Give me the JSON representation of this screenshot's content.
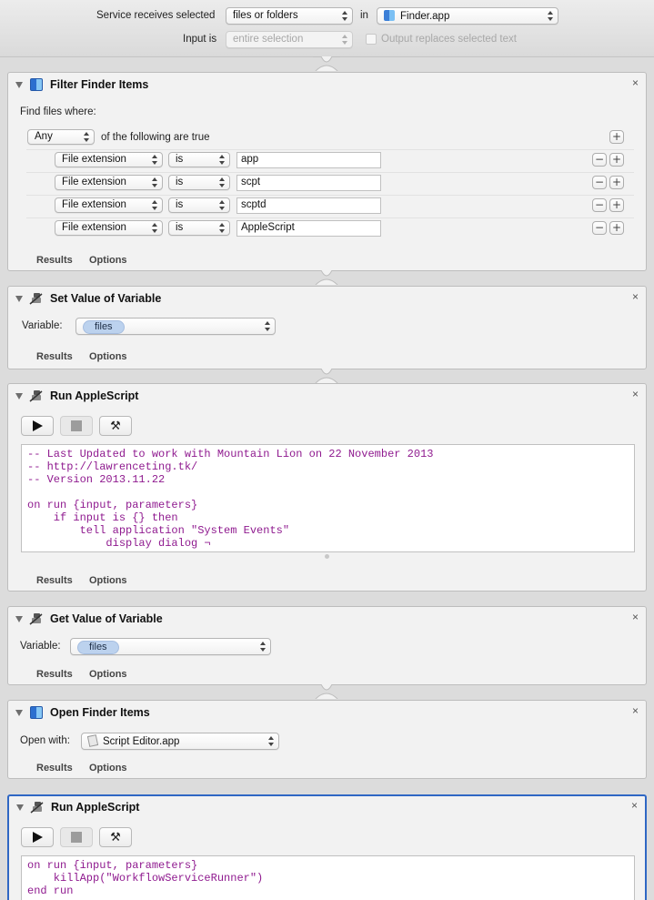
{
  "header": {
    "service_label": "Service receives selected",
    "input_type": "files or folders",
    "in_label": "in",
    "app": "Finder.app",
    "input_is_label": "Input is",
    "input_is_value": "entire selection",
    "output_replaces_label": "Output replaces selected text"
  },
  "filter": {
    "title": "Filter Finder Items",
    "find_label": "Find files where:",
    "match": "Any",
    "match_suffix": "of the following are true",
    "rules": [
      {
        "field": "File extension",
        "op": "is",
        "value": "app"
      },
      {
        "field": "File extension",
        "op": "is",
        "value": "scpt"
      },
      {
        "field": "File extension",
        "op": "is",
        "value": "scptd"
      },
      {
        "field": "File extension",
        "op": "is",
        "value": "AppleScript"
      }
    ]
  },
  "set_var": {
    "title": "Set Value of Variable",
    "variable_label": "Variable:",
    "variable": "files"
  },
  "script1": {
    "title": "Run AppleScript",
    "code": "-- Last Updated to work with Mountain Lion on 22 November 2013\n-- http://lawrenceting.tk/\n-- Version 2013.11.22\n\non run {input, parameters}\n    if input is {} then\n        tell application \"System Events\"\n            display dialog ¬"
  },
  "get_var": {
    "title": "Get Value of Variable",
    "variable_label": "Variable:",
    "variable": "files"
  },
  "open_finder": {
    "title": "Open Finder Items",
    "open_with_label": "Open with:",
    "app": "Script Editor.app"
  },
  "script2": {
    "title": "Run AppleScript",
    "code": "on run {input, parameters}\n    killApp(\"WorkflowServiceRunner\")\nend run"
  },
  "footer": {
    "results": "Results",
    "options": "Options"
  },
  "icons": {
    "close": "×",
    "plus": "+",
    "minus": "−",
    "hammer": "⚒"
  },
  "colors": {
    "selected_border": "#2f67c4",
    "script_text": "#8f1a8f",
    "token_bg": "#bcd2ee"
  }
}
